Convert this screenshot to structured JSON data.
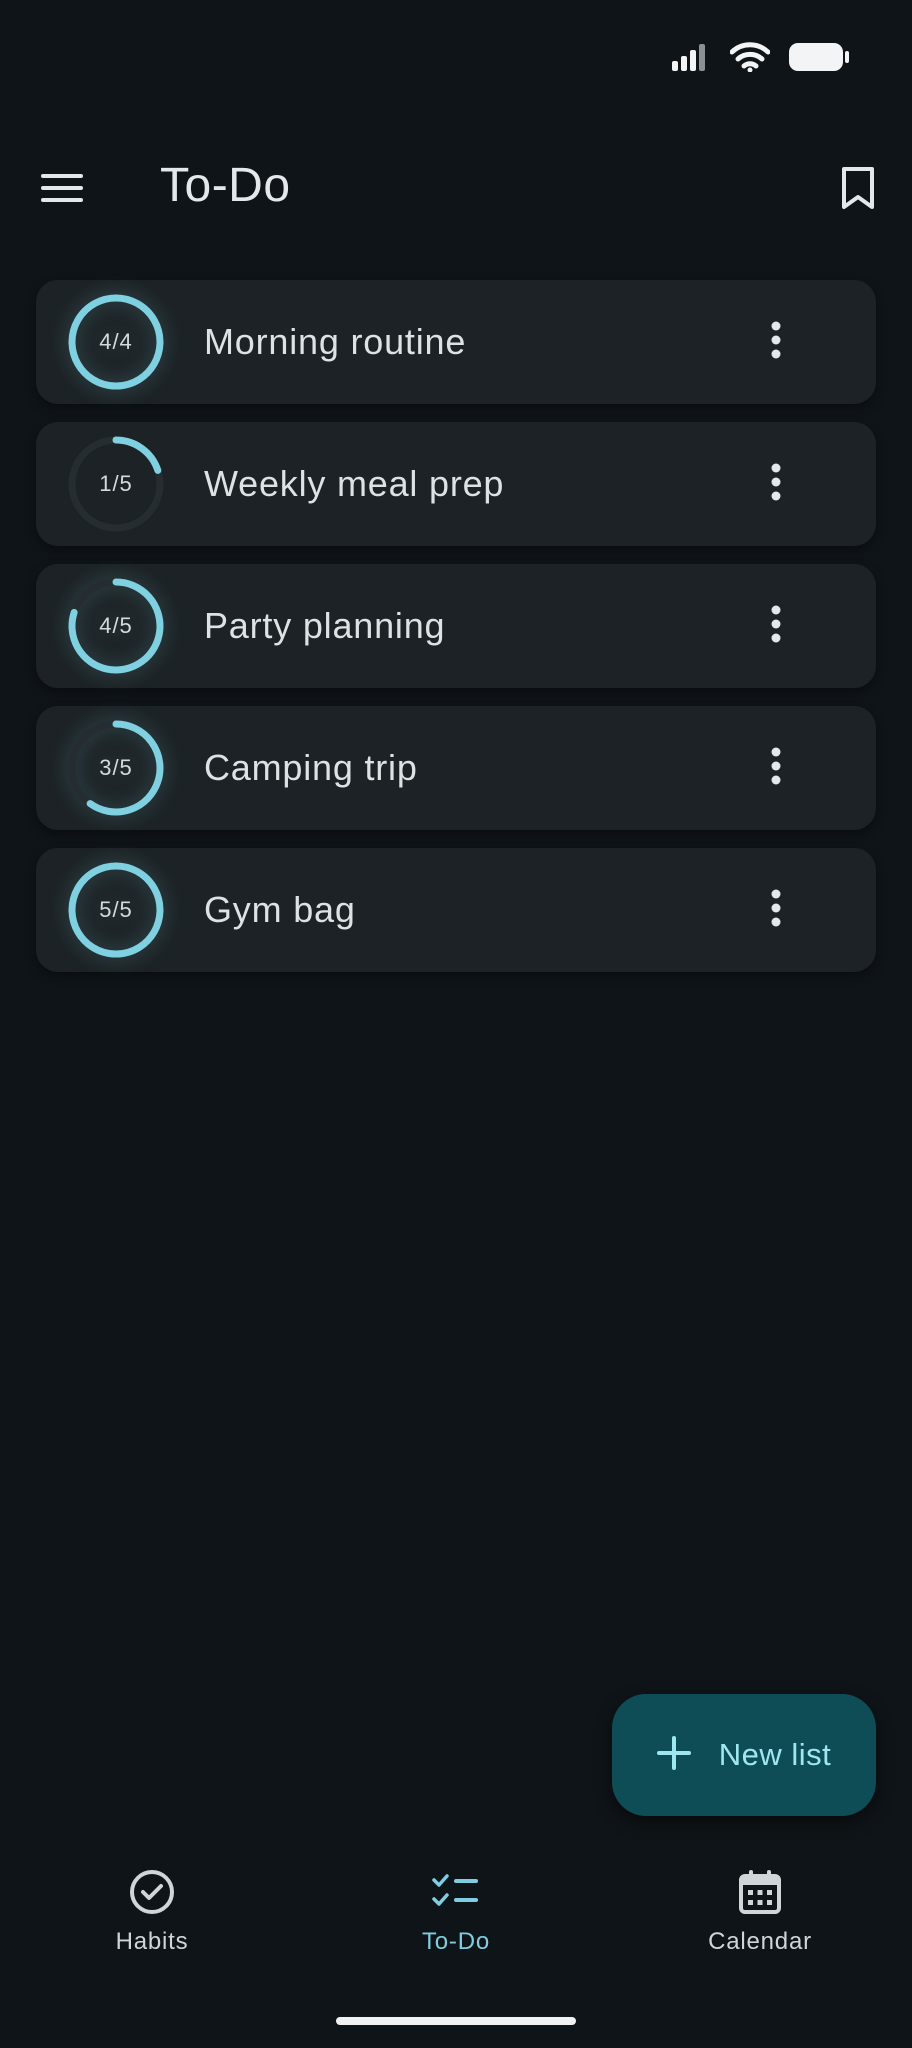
{
  "colors": {
    "background": "#0f1418",
    "card": "#1c2225",
    "accent": "#7fd0e0",
    "track": "#262d30",
    "fab": "#0e4d56",
    "fab_text": "#9fe6f0"
  },
  "status_bar": {
    "icons": [
      "signal-icon",
      "wifi-icon",
      "battery-icon"
    ]
  },
  "app_bar": {
    "title": "To-Do",
    "menu_icon": "menu-icon",
    "bookmark_icon": "bookmark-icon"
  },
  "lists": [
    {
      "name": "Morning routine",
      "done": 4,
      "total": 4,
      "progress_text": "4/4"
    },
    {
      "name": "Weekly meal prep",
      "done": 1,
      "total": 5,
      "progress_text": "1/5"
    },
    {
      "name": "Party planning",
      "done": 4,
      "total": 5,
      "progress_text": "4/5"
    },
    {
      "name": "Camping trip",
      "done": 3,
      "total": 5,
      "progress_text": "3/5"
    },
    {
      "name": "Gym bag",
      "done": 5,
      "total": 5,
      "progress_text": "5/5"
    }
  ],
  "fab": {
    "label": "New list",
    "icon": "plus-icon"
  },
  "bottom_nav": {
    "items": [
      {
        "label": "Habits",
        "icon": "check-circle-icon",
        "active": false
      },
      {
        "label": "To-Do",
        "icon": "checklist-icon",
        "active": true
      },
      {
        "label": "Calendar",
        "icon": "calendar-icon",
        "active": false
      }
    ]
  }
}
